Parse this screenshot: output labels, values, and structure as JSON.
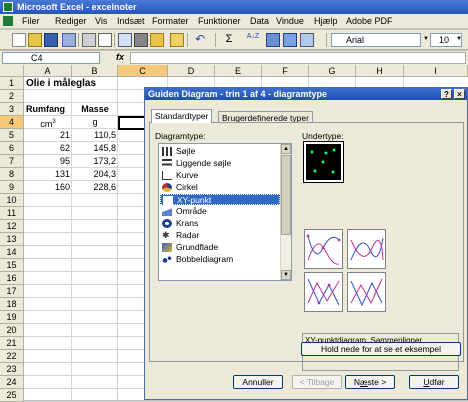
{
  "window": {
    "title": "Microsoft Excel - excelnoter"
  },
  "menu": [
    "Filer",
    "Rediger",
    "Vis",
    "Indsæt",
    "Formater",
    "Funktioner",
    "Data",
    "Vindue",
    "Hjælp",
    "Adobe PDF"
  ],
  "toolbar": {
    "font": "Arial",
    "size": "10"
  },
  "formula_bar": {
    "cell_ref": "C4",
    "fx": "fx",
    "value": ""
  },
  "grid": {
    "columns": [
      "A",
      "B",
      "C",
      "D",
      "E",
      "F",
      "G",
      "H",
      "I"
    ],
    "rows": [
      "1",
      "2",
      "3",
      "4",
      "5",
      "6",
      "7",
      "8",
      "9",
      "10",
      "11",
      "12",
      "13",
      "14",
      "15",
      "16",
      "17",
      "18",
      "19",
      "20",
      "21",
      "22",
      "23",
      "24",
      "25"
    ],
    "title": "Olie i måleglas",
    "header_a": "Rumfang",
    "header_b": "Masse",
    "unit_a": "cm",
    "unit_a_sup": "3",
    "unit_b": "g",
    "data": [
      {
        "a": "21",
        "b": "110,5"
      },
      {
        "a": "62",
        "b": "145,8"
      },
      {
        "a": "95",
        "b": "173,2"
      },
      {
        "a": "131",
        "b": "204,3"
      },
      {
        "a": "160",
        "b": "228,6"
      }
    ]
  },
  "dialog": {
    "title": "Guiden Diagram - trin 1 af 4 - diagramtype",
    "help": "?",
    "close": "×",
    "tabs": [
      "Standardtyper",
      "Brugerdefinerede typer"
    ],
    "list_label": "Diagramtype:",
    "sub_label": "Undertype:",
    "chart_types": [
      "Søjle",
      "Liggende søjle",
      "Kurve",
      "Cirkel",
      "XY-punkt",
      "Område",
      "Krans",
      "Radar",
      "Grundflade",
      "Bobbeldiagram"
    ],
    "selected_index": 4,
    "description": "XY-punktdiagram. Sammenligner værdipar.",
    "preview_button": "Hold nede for at se et eksempel",
    "buttons": {
      "cancel": "Annuller",
      "back": "< Tilbage",
      "next": "Næste >",
      "finish": "Udfør"
    }
  }
}
